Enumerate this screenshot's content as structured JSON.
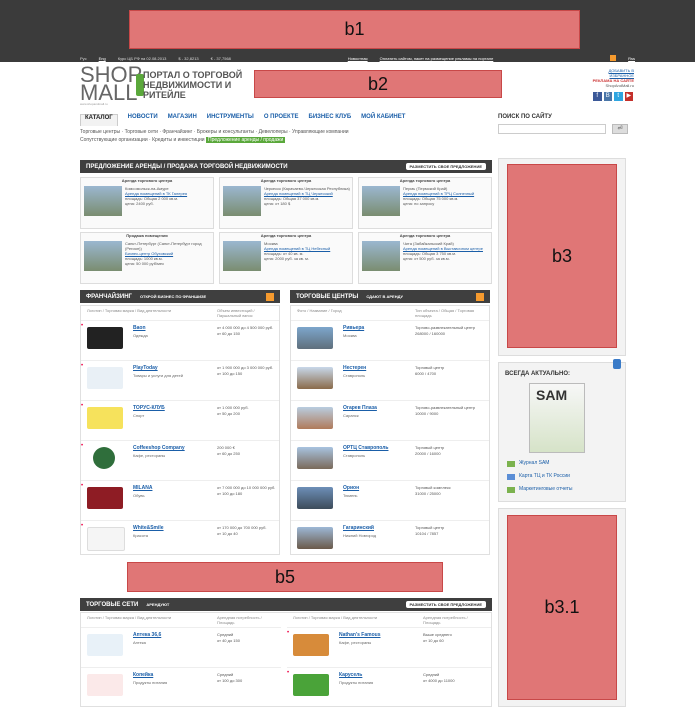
{
  "util": {
    "lang_ru": "Рус",
    "lang_en": "Eng",
    "rates": "Курс ЦБ РФ на 02.08.2013",
    "usd": "$ - 32,8213",
    "eur": "€ - 37,7568",
    "news": "Новостная",
    "notice": "Оплатить сайтом, пакет на размещение рекламы на портале",
    "rss": "Rss"
  },
  "header": {
    "logo_line1": "SHOP",
    "logo_line2": "MALL",
    "logo_url": "www.shopandmall.ru",
    "portal_title": "ПОРТАЛ О ТОРГОВОЙ НЕДВИЖИМОСТИ И РИТЕЙЛЕ",
    "right_link1": "ДОБАВИТЬ В ИЗБРАННОЕ",
    "right_link2": "РЕКЛАМА НА САЙТЕ",
    "email": "ShopAndMall.ru",
    "social": [
      "f",
      "В",
      "t",
      "▶"
    ]
  },
  "nav": {
    "items": [
      "КАТАЛОГ",
      "НОВОСТИ",
      "МАГАЗИН",
      "ИНСТРУМЕНТЫ",
      "О ПРОЕКТЕ",
      "БИЗНЕС КЛУБ",
      "МОЙ КАБИНЕТ"
    ],
    "sub": [
      "Торговые центры",
      "Торговые сети",
      "Франчайзинг",
      "Брокеры и консультанты",
      "Девелоперы",
      "Управляющие компании",
      "Сопутствующие организации",
      "Кредиты и инвестиции"
    ],
    "sub_highlight": "Предложение аренды / продажи"
  },
  "search": {
    "label": "ПОИСК ПО САЙТУ",
    "button": "⏎"
  },
  "offers": {
    "title": "ПРЕДЛОЖЕНИЕ АРЕНДЫ / ПРОДАЖА ТОРГОВОЙ НЕДВИЖИМОСТИ",
    "button": "РАЗМЕСТИТЬ СВОЕ ПРЕДЛОЖЕНИЕ",
    "cards": [
      {
        "type": "Аренда торгового центра",
        "city": "Комсомольск-на-Амуре",
        "link": "Аренда помещений в ТК Галерея",
        "area": "площадь: Общая 2 000 кв.м.",
        "price": "цена: 2400 руб."
      },
      {
        "type": "Аренда торгового центра",
        "city": "Черкесск (Карачаево-Черкесская Республика)",
        "link": "Аренда помещений в ТЦ Черкесский",
        "area": "площадь: Общая 37 000 кв.м.",
        "price": "цена: от 180 $"
      },
      {
        "type": "Аренда торгового центра",
        "city": "Пермь (Пермский Край)",
        "link": "Аренда помещений в ТРЦ Солнечный",
        "area": "площадь: Общая 75 000 кв.м.",
        "price": "цена: по запросу"
      },
      {
        "type": "Продажа помещения",
        "city": "Санкт-Петербург (Санкт-Петербург город (Регион))",
        "link": "Бизнес-центр Обуховский",
        "area": "площадь: 1000 кв.м.",
        "price": "цена: 50 000 руб/мес"
      },
      {
        "type": "Аренда торгового центра",
        "city": "Москва",
        "link": "Аренда помещений в ТЦ Небесный",
        "area": "площадь: от 40 кв. м.",
        "price": "цена: 2000 руб. за кв. м."
      },
      {
        "type": "Аренда торгового центра",
        "city": "Чита (Забайкальский Край)",
        "link": "Аренда помещений в Выставочном центре",
        "area": "площадь: Общая 3 750 кв.м.",
        "price": "цена: от 500 руб. за кв.м."
      }
    ]
  },
  "franchise": {
    "title": "ФРАНЧАЙЗИНГ",
    "subtitle": "ОТКРОЙ БИЗНЕС ПО ФРАНШИЗЕ",
    "col1": "Логотип / Торговая марка / Вид деятельности",
    "col2": "Объем инвестиций / Паушальный взнос",
    "items": [
      {
        "name": "Baon",
        "sub": "Одежда",
        "val1": "от 4 000 000 до 4 500 000 руб.",
        "val2": "от 60 до 150"
      },
      {
        "name": "PlayToday",
        "sub": "Товары и услуги для детей",
        "val1": "от 1 900 000 до 3 000 000 руб.",
        "val2": "от 100 до 150"
      },
      {
        "name": "ТОРУС-КЛУБ",
        "sub": "Спорт",
        "val1": "от 1 000 000 руб.",
        "val2": "от 50 до 200"
      },
      {
        "name": "Coffeeshop Company",
        "sub": "Кафе, рестораны",
        "val1": "200 000 €",
        "val2": "от 60 до 250"
      },
      {
        "name": "MILANA",
        "sub": "Обувь",
        "val1": "от 7 000 000 до 10 000 000 руб.",
        "val2": "от 100 до 180"
      },
      {
        "name": "White&Smile",
        "sub": "Красота",
        "val1": "от 170 000 до 700 000 руб.",
        "val2": "от 10 до 40"
      }
    ]
  },
  "malls": {
    "title": "ТОРГОВЫЕ ЦЕНТРЫ",
    "subtitle": "СДАЮТ В АРЕНДУ",
    "col1": "Фото / Название / Город",
    "col2": "Тип объекта / Общая / Торговая площадь",
    "items": [
      {
        "name": "Ривьера",
        "sub": "Москва",
        "val1": "Торгово-развлекательный центр",
        "val2": "268000 / 160000"
      },
      {
        "name": "Нестерен",
        "sub": "Ставрополь",
        "val1": "Торговый центр",
        "val2": "6000 / 4700"
      },
      {
        "name": "Огарев Плаза",
        "sub": "Саранск",
        "val1": "Торгово-развлекательный центр",
        "val2": "10000 / 9000"
      },
      {
        "name": "ОРТЦ Ставрополь",
        "sub": "Ставрополь",
        "val1": "Торговый центр",
        "val2": "20000 / 16000"
      },
      {
        "name": "Орион",
        "sub": "Тюмень",
        "val1": "Торговый комплекс",
        "val2": "31000 / 25000"
      },
      {
        "name": "Гагаринский",
        "sub": "Нижний Новгород",
        "val1": "Торговый центр",
        "val2": "10104 / 7857"
      }
    ]
  },
  "chains": {
    "title": "ТОРГОВЫЕ СЕТИ",
    "subtitle": "АРЕНДУЮТ",
    "button": "РАЗМЕСТИТЬ СВОЕ ПРЕДЛОЖЕНИЕ",
    "col1": "Логотип / Торговая марка / Вид деятельности",
    "col2": "Арендная потребность / Площадь",
    "items": [
      {
        "name": "Аптека 36,6",
        "sub": "Аптека",
        "val1": "Средний",
        "val2": "от 40 до 150"
      },
      {
        "name": "Nathan's Famous",
        "sub": "Кафе, рестораны",
        "val1": "Выше среднего",
        "val2": "от 10 до 60"
      },
      {
        "name": "Копейка",
        "sub": "Продукты питания",
        "val1": "Средний",
        "val2": "от 100 до 300"
      },
      {
        "name": "Карусель",
        "sub": "Продукты питания",
        "val1": "Средний",
        "val2": "от 4000 до 11000"
      }
    ]
  },
  "actual": {
    "title": "ВСЕГДА АКТУАЛЬНО:",
    "magazine": "SAM",
    "links": [
      "Журнал SAM",
      "Карта ТЦ и ТК России",
      "Маркетинговые отчеты"
    ]
  },
  "placeholders": {
    "b1": "b1",
    "b2": "b2",
    "b3": "b3",
    "b31": "b3.1",
    "b5": "b5"
  },
  "colors": {
    "topbar": "#3b3b3b",
    "link": "#1a5ea8",
    "accent": "#5aa83b",
    "placeholder": "#e07676"
  }
}
